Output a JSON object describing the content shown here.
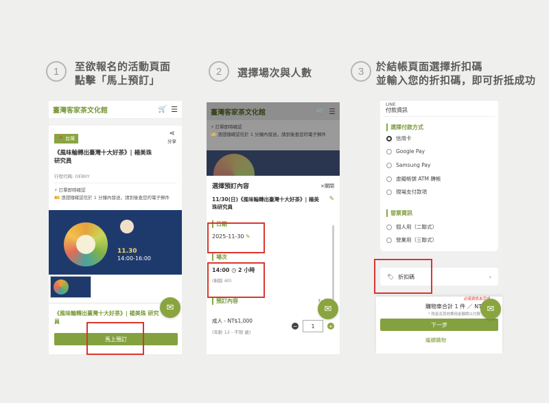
{
  "steps": [
    {
      "num": "1",
      "title": "至欲報名的活動頁面\n點擊「馬上預訂」"
    },
    {
      "num": "2",
      "title": "選擇場次與人數"
    },
    {
      "num": "3",
      "title": "於結帳頁面選擇折扣碼\n並輸入您的折扣碼，即可折抵成功"
    }
  ],
  "brand": "臺灣客家茶文化館",
  "p1": {
    "tag": "台灣",
    "share": "分享",
    "event_title": "《風味輪轉出臺灣十大好茶》| 楊美珠 研究員",
    "code": "行程代碼: OEBIIY",
    "confirm": "訂單即時確認",
    "voucher": "憑證隨確認信於 1 分鐘內發送，請到後查您的電子郵件",
    "footer_title": "《風味輪轉出臺灣十大好茶》| 楊美珠 研究員",
    "book_btn": "馬上預訂"
  },
  "p2": {
    "confirm": "訂單即時確認",
    "voucher": "憑證隨確認信於 1 分鐘內發送，請到後查您的電子郵件",
    "sheet_title": "選擇預訂內容",
    "close": "×關閉",
    "event_line": "11/30(日)《風味輪轉出臺灣十大好茶》| 楊美珠研究員",
    "date_label": "日期",
    "date_value": "2025-11-30",
    "session_label": "場次",
    "session_time": "14:00",
    "session_duration": "2 小時",
    "session_left": "(剩餘 40)",
    "content_label": "預訂內容",
    "clear": "清除",
    "ticket_name": "成人 - NT$1,000",
    "ticket_note": "(年齡 12 - 不限 歲)",
    "qty": "1"
  },
  "p3": {
    "line_tag": "LINE",
    "pay_info": "付款資訊",
    "pay_method": "選擇付款方式",
    "methods": [
      "信用卡",
      "Google Pay",
      "Samsung Pay",
      "虛擬帳號 ATM 轉帳",
      "現場支付款項"
    ],
    "invoice": "發票資訊",
    "invoice_opts": [
      "個人用（二聯式）",
      "營業用（三聯式）"
    ],
    "discount": "折扣碼",
    "required": "必填資訊未完成",
    "total": "購物車合計 1 件 ／ NT",
    "tax_note": "* 稅金及其他費用金額請以付款",
    "next": "下一步",
    "continue": "繼續購物"
  },
  "colors": {
    "brand_green": "#7a9a3a",
    "highlight_red": "#d9342b"
  }
}
